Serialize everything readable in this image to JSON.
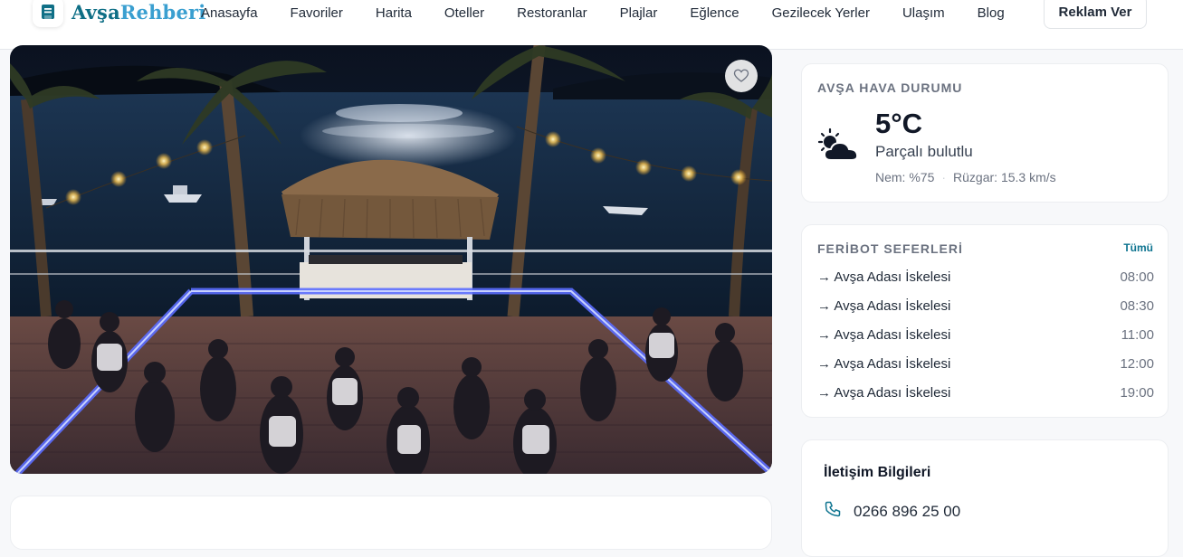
{
  "header": {
    "logo": {
      "part1": "Avşa",
      "part2": "Rehberi",
      "icon": "bookmark-book-icon"
    },
    "menu": [
      "Anasayfa",
      "Favoriler",
      "Harita",
      "Oteller",
      "Restoranlar",
      "Plajlar",
      "Eğlence",
      "Gezilecek Yerler",
      "Ulaşım",
      "Blog"
    ],
    "cta_label": "Reklam Ver"
  },
  "hero": {
    "favorite_icon": "heart-outline-icon"
  },
  "weather": {
    "title": "AVŞA HAVA DURUMU",
    "temperature": "5°C",
    "condition": "Parçalı bulutlu",
    "humidity": "Nem: %75",
    "wind": "Rüzgar: 15.3 km/s",
    "icon": "cloud-sun-icon"
  },
  "ferry": {
    "title": "FERİBOT SEFERLERİ",
    "all_link": "Tümü",
    "rows": [
      {
        "destination": "→ Avşa Adası İskelesi",
        "time": "08:00"
      },
      {
        "destination": "→ Avşa Adası İskelesi",
        "time": "08:30"
      },
      {
        "destination": "→ Avşa Adası İskelesi",
        "time": "11:00"
      },
      {
        "destination": "→ Avşa Adası İskelesi",
        "time": "12:00"
      },
      {
        "destination": "→ Avşa Adası İskelesi",
        "time": "19:00"
      }
    ]
  },
  "contact": {
    "title": "İletişim Bilgileri",
    "phone": "0266 896 25 00",
    "phone_icon": "phone-icon"
  },
  "colors": {
    "brand_dark": "#0f6f86",
    "brand_light": "#3a9fd0",
    "link": "#0e7490"
  }
}
